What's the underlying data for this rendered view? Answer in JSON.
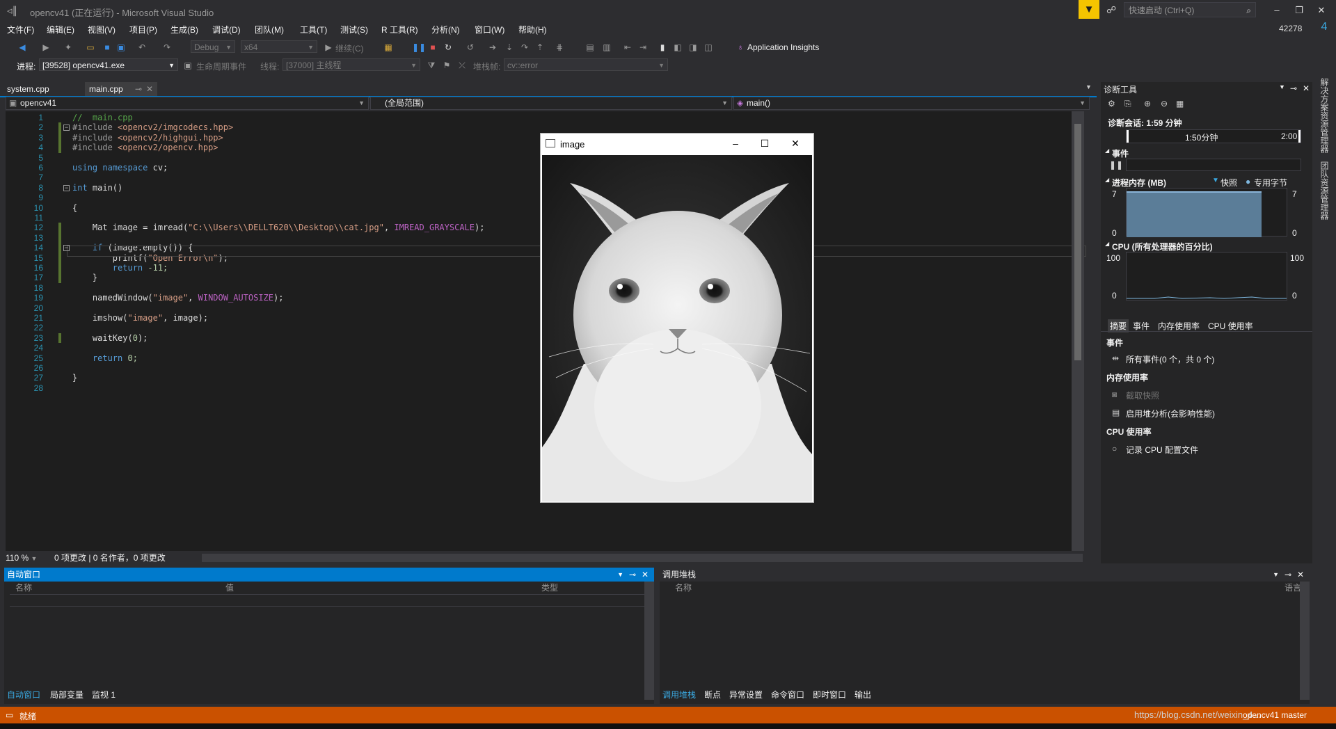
{
  "window": {
    "title": "opencv41 (正在运行) - Microsoft Visual Studio",
    "logo": "vs-logo-icon"
  },
  "quick_launch": {
    "placeholder": "快速启动 (Ctrl+Q)"
  },
  "window_controls": {
    "minimize": "–",
    "restore": "❐",
    "close": "✕"
  },
  "menu": [
    "文件(F)",
    "编辑(E)",
    "视图(V)",
    "项目(P)",
    "生成(B)",
    "调试(D)",
    "团队(M)",
    "工具(T)",
    "测试(S)",
    "R 工具(R)",
    "分析(N)",
    "窗口(W)",
    "帮助(H)"
  ],
  "user": {
    "id": "42278",
    "notification": "4"
  },
  "toolbar1": {
    "config": "Debug",
    "platform": "x64",
    "continue": "继续(C)",
    "insights": "Application Insights"
  },
  "toolbar2": {
    "process_label": "进程:",
    "process": "[39528] opencv41.exe",
    "lifecycle": "生命周期事件",
    "thread_label": "线程:",
    "thread": "[37000] 主线程",
    "stack_label": "堆栈帧:",
    "stack": "cv::error"
  },
  "doc_tabs": [
    {
      "label": "system.cpp"
    },
    {
      "label": "main.cpp",
      "active": true
    }
  ],
  "navbar": {
    "project": "opencv41",
    "scope": "(全局范围)",
    "member": "main()"
  },
  "code_lines": [
    [
      {
        "t": "//  main.cpp",
        "c": "cm"
      }
    ],
    [
      {
        "t": "#include ",
        "c": "pp"
      },
      {
        "t": "<opencv2/imgcodecs.hpp>",
        "c": "inc"
      }
    ],
    [
      {
        "t": "#include ",
        "c": "pp"
      },
      {
        "t": "<opencv2/highgui.hpp>",
        "c": "inc"
      }
    ],
    [
      {
        "t": "#include ",
        "c": "pp"
      },
      {
        "t": "<opencv2/opencv.hpp>",
        "c": "inc"
      }
    ],
    [],
    [
      {
        "t": "using ",
        "c": "kw"
      },
      {
        "t": "namespace ",
        "c": "kw"
      },
      {
        "t": "cv;",
        "c": "id"
      }
    ],
    [],
    [
      {
        "t": "int ",
        "c": "kw"
      },
      {
        "t": "main()",
        "c": "id"
      }
    ],
    [],
    [
      {
        "t": "{",
        "c": "id"
      }
    ],
    [],
    [
      {
        "t": "    Mat image = ",
        "c": "id"
      },
      {
        "t": "imread",
        "c": "id"
      },
      {
        "t": "(",
        "c": "id"
      },
      {
        "t": "\"C:\\\\Users\\\\DELLT620\\\\Desktop\\\\cat.jpg\"",
        "c": "str"
      },
      {
        "t": ", ",
        "c": "id"
      },
      {
        "t": "IMREAD_GRAYSCALE",
        "c": "mac"
      },
      {
        "t": ");",
        "c": "id"
      }
    ],
    [],
    [
      {
        "t": "    if ",
        "c": "kw"
      },
      {
        "t": "(image.empty()) {",
        "c": "id"
      }
    ],
    [
      {
        "t": "        printf(",
        "c": "id"
      },
      {
        "t": "\"Open Error\\n\"",
        "c": "str"
      },
      {
        "t": ");",
        "c": "id"
      }
    ],
    [
      {
        "t": "        return ",
        "c": "kw"
      },
      {
        "t": "-11;",
        "c": "num"
      }
    ],
    [
      {
        "t": "    }",
        "c": "id"
      }
    ],
    [],
    [
      {
        "t": "    namedWindow(",
        "c": "id"
      },
      {
        "t": "\"image\"",
        "c": "str"
      },
      {
        "t": ", ",
        "c": "id"
      },
      {
        "t": "WINDOW_AUTOSIZE",
        "c": "mac"
      },
      {
        "t": ");",
        "c": "id"
      }
    ],
    [],
    [
      {
        "t": "    imshow(",
        "c": "id"
      },
      {
        "t": "\"image\"",
        "c": "str"
      },
      {
        "t": ", image);",
        "c": "id"
      }
    ],
    [],
    [
      {
        "t": "    waitKey(",
        "c": "id"
      },
      {
        "t": "0",
        "c": "num"
      },
      {
        "t": ");",
        "c": "id"
      }
    ],
    [],
    [
      {
        "t": "    return ",
        "c": "kw"
      },
      {
        "t": "0;",
        "c": "num"
      }
    ],
    [],
    [
      {
        "t": "}",
        "c": "id"
      }
    ],
    []
  ],
  "image_window": {
    "title": "image",
    "icon": "image-window-icon"
  },
  "editor_status": {
    "zoom": "110 %",
    "changes": "0 项更改 | 0 名作者，0 项更改"
  },
  "autos": {
    "title": "自动窗口",
    "cols": [
      "名称",
      "值",
      "类型"
    ],
    "tabs": [
      "自动窗口",
      "局部变量",
      "监视 1"
    ]
  },
  "callstack": {
    "title": "调用堆栈",
    "cols": [
      "名称",
      "语言"
    ],
    "tabs": [
      "调用堆栈",
      "断点",
      "异常设置",
      "命令窗口",
      "即时窗口",
      "输出"
    ]
  },
  "diag": {
    "title": "诊断工具",
    "session": "诊断会话: 1:59 分钟",
    "timeline": [
      "1:50分钟",
      "2:00"
    ],
    "events_label": "事件",
    "memory_label": "进程内存 (MB)",
    "snapshot_legend": "快照",
    "private_legend": "专用字节",
    "mem_max": "7",
    "mem_min": "0",
    "cpu_label": "CPU (所有处理器的百分比)",
    "cpu_max": "100",
    "cpu_min": "0",
    "tabs": [
      "摘要",
      "事件",
      "内存使用率",
      "CPU 使用率"
    ],
    "sec_events": "事件",
    "all_events": "所有事件(0 个，共 0 个)",
    "sec_memory": "内存使用率",
    "snapshot": "截取快照",
    "heap": "启用堆分析(会影响性能)",
    "sec_cpu": "CPU 使用率",
    "cpu_profile": "记录 CPU 配置文件"
  },
  "side_tabs": [
    "解决方案资源管理器",
    "团队资源管理器"
  ],
  "status": {
    "text": "就绪",
    "watermark": "https://blog.csdn.net/weixin_4...",
    "right": "opencv41    master"
  },
  "colors": {
    "status": "#ca5100",
    "accent": "#007acc",
    "editor_bg": "#1e1e1e"
  }
}
